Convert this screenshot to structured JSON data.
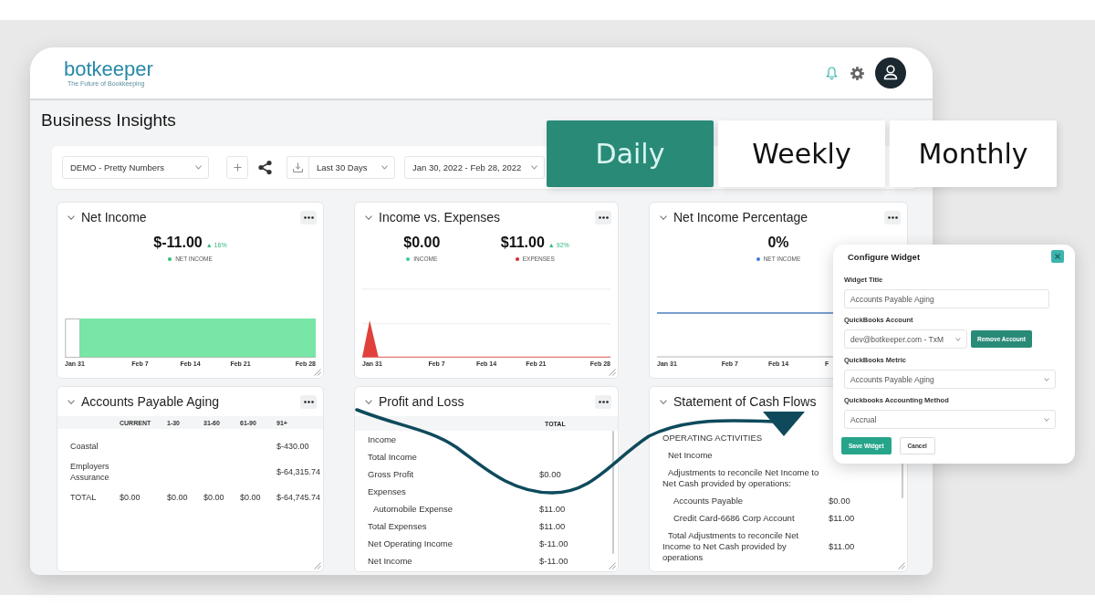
{
  "header": {
    "logo": "botkeeper",
    "tagline": "The Future of Bookkeeping"
  },
  "page_title": "Business Insights",
  "toolbar": {
    "dashboard": "DEMO - Pretty Numbers",
    "range": "Last 30 Days",
    "dates": "Jan 30, 2022 - Feb 28, 2022"
  },
  "period_tabs": [
    {
      "label": "Daily",
      "selected": true
    },
    {
      "label": "Weekly",
      "selected": false
    },
    {
      "label": "Monthly",
      "selected": false
    }
  ],
  "widgets": [
    {
      "kind": "area",
      "title": "Net Income",
      "menu": true,
      "resize_handle": true,
      "metrics": [
        {
          "value": "$-11.00",
          "change": "▲ 16%",
          "legend": "NET INCOME",
          "color": "#2fbf71"
        }
      ],
      "axis_labels": [
        "Jan 31",
        "Feb 7",
        "Feb 14",
        "Feb 21",
        "Feb 28"
      ]
    },
    {
      "kind": "spike",
      "title": "Income vs. Expenses",
      "menu": true,
      "resize_handle": true,
      "metrics": [
        {
          "value": "$0.00",
          "legend": "INCOME",
          "color": "#3cc9a0"
        },
        {
          "value": "$11.00",
          "change": "▲ 92%",
          "legend": "EXPENSES",
          "color": "#d42a2a"
        }
      ],
      "axis_labels": [
        "Jan 31",
        "Feb 7",
        "Feb 14",
        "Feb 21",
        "Feb 28"
      ]
    },
    {
      "kind": "line",
      "title": "Net Income Percentage",
      "menu": true,
      "resize_handle": false,
      "metrics": [
        {
          "value": "0%",
          "legend": "NET INCOME",
          "color": "#3b7dd8"
        }
      ],
      "axis_labels": [
        "Jan 31",
        "Feb 7",
        "Feb 14",
        "F"
      ]
    },
    {
      "kind": "aging",
      "title": "Accounts Payable Aging",
      "menu": true,
      "resize_handle": true,
      "columns": [
        "CURRENT",
        "1-30",
        "31-60",
        "61-90",
        "91+"
      ],
      "rows": [
        {
          "label": "Coastal",
          "cells": [
            null,
            null,
            null,
            null,
            "$-430.00"
          ]
        },
        {
          "label": "Employers Assurance",
          "cells": [
            null,
            null,
            null,
            null,
            "$-64,315.74"
          ]
        },
        {
          "label": "TOTAL",
          "cells": [
            "$0.00",
            "$0.00",
            "$0.00",
            "$0.00",
            "$-64,745.74"
          ]
        }
      ]
    },
    {
      "kind": "report",
      "title": "Profit and Loss",
      "menu": true,
      "resize_handle": true,
      "column_header": "TOTAL",
      "rows": [
        {
          "label": "Income"
        },
        {
          "label": "Total Income"
        },
        {
          "label": "Gross Profit",
          "value": "$0.00"
        },
        {
          "label": "Expenses",
          "children": [
            {
              "label": "Automobile Expense",
              "value": "$11.00"
            }
          ]
        },
        {
          "label": "Total Expenses",
          "value": "$11.00"
        },
        {
          "label": "Net Operating Income",
          "value": "$-11.00"
        },
        {
          "label": "Net Income",
          "value": "$-11.00"
        }
      ]
    },
    {
      "kind": "report",
      "title": "Statement of Cash Flows",
      "menu": false,
      "resize_handle": true,
      "rows": [
        {
          "label": "OPERATING ACTIVITIES",
          "children": [
            {
              "label": "Net Income"
            },
            {
              "label": "Adjustments to reconcile Net Income to Net Cash provided by operations:",
              "children": [
                {
                  "label": "Accounts Payable",
                  "value": "$0.00"
                },
                {
                  "label": "Credit Card-6686 Corp Account",
                  "value": "$11.00"
                }
              ]
            },
            {
              "label": "Total Adjustments to reconcile Net Income to Net Cash provided by operations",
              "value": "$11.00"
            }
          ]
        }
      ]
    }
  ],
  "configure_widget": {
    "title": "Configure Widget",
    "fields": [
      {
        "kind": "input",
        "label": "Widget Title",
        "value": "Accounts Payable Aging"
      },
      {
        "kind": "select",
        "label": "QuickBooks Account",
        "value": "dev@botkeeper.com - TxM",
        "action": "Remove Account"
      },
      {
        "kind": "select",
        "label": "QuickBooks Metric",
        "value": "Accounts Payable Aging"
      },
      {
        "kind": "select",
        "label": "Quickbooks Accounting Method",
        "value": "Accrual"
      }
    ],
    "buttons": [
      {
        "kind": "primary",
        "label": "Save Widget"
      },
      {
        "kind": "secondary",
        "label": "Cancel"
      }
    ]
  }
}
